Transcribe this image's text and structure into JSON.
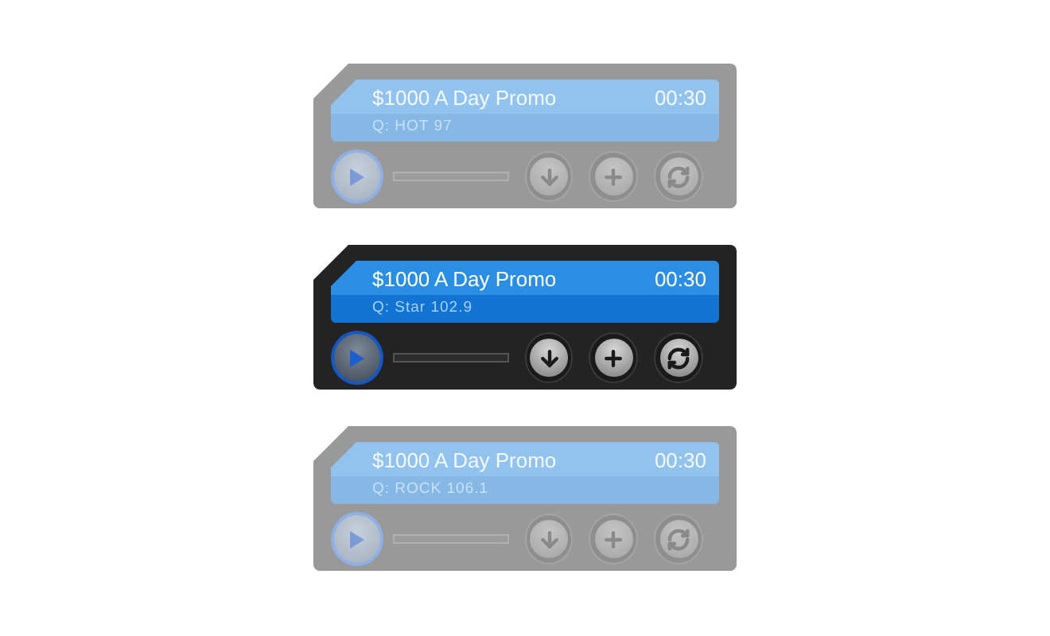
{
  "players": [
    {
      "active": false,
      "title": "$1000 A Day Promo",
      "duration": "00:30",
      "station": "Q: HOT 97",
      "level": 0
    },
    {
      "active": true,
      "title": "$1000 A Day Promo",
      "duration": "00:30",
      "station": "Q: Star 102.9",
      "level": 0
    },
    {
      "active": false,
      "title": "$1000 A Day Promo",
      "duration": "00:30",
      "station": "Q: ROCK 106.1",
      "level": 0
    }
  ]
}
